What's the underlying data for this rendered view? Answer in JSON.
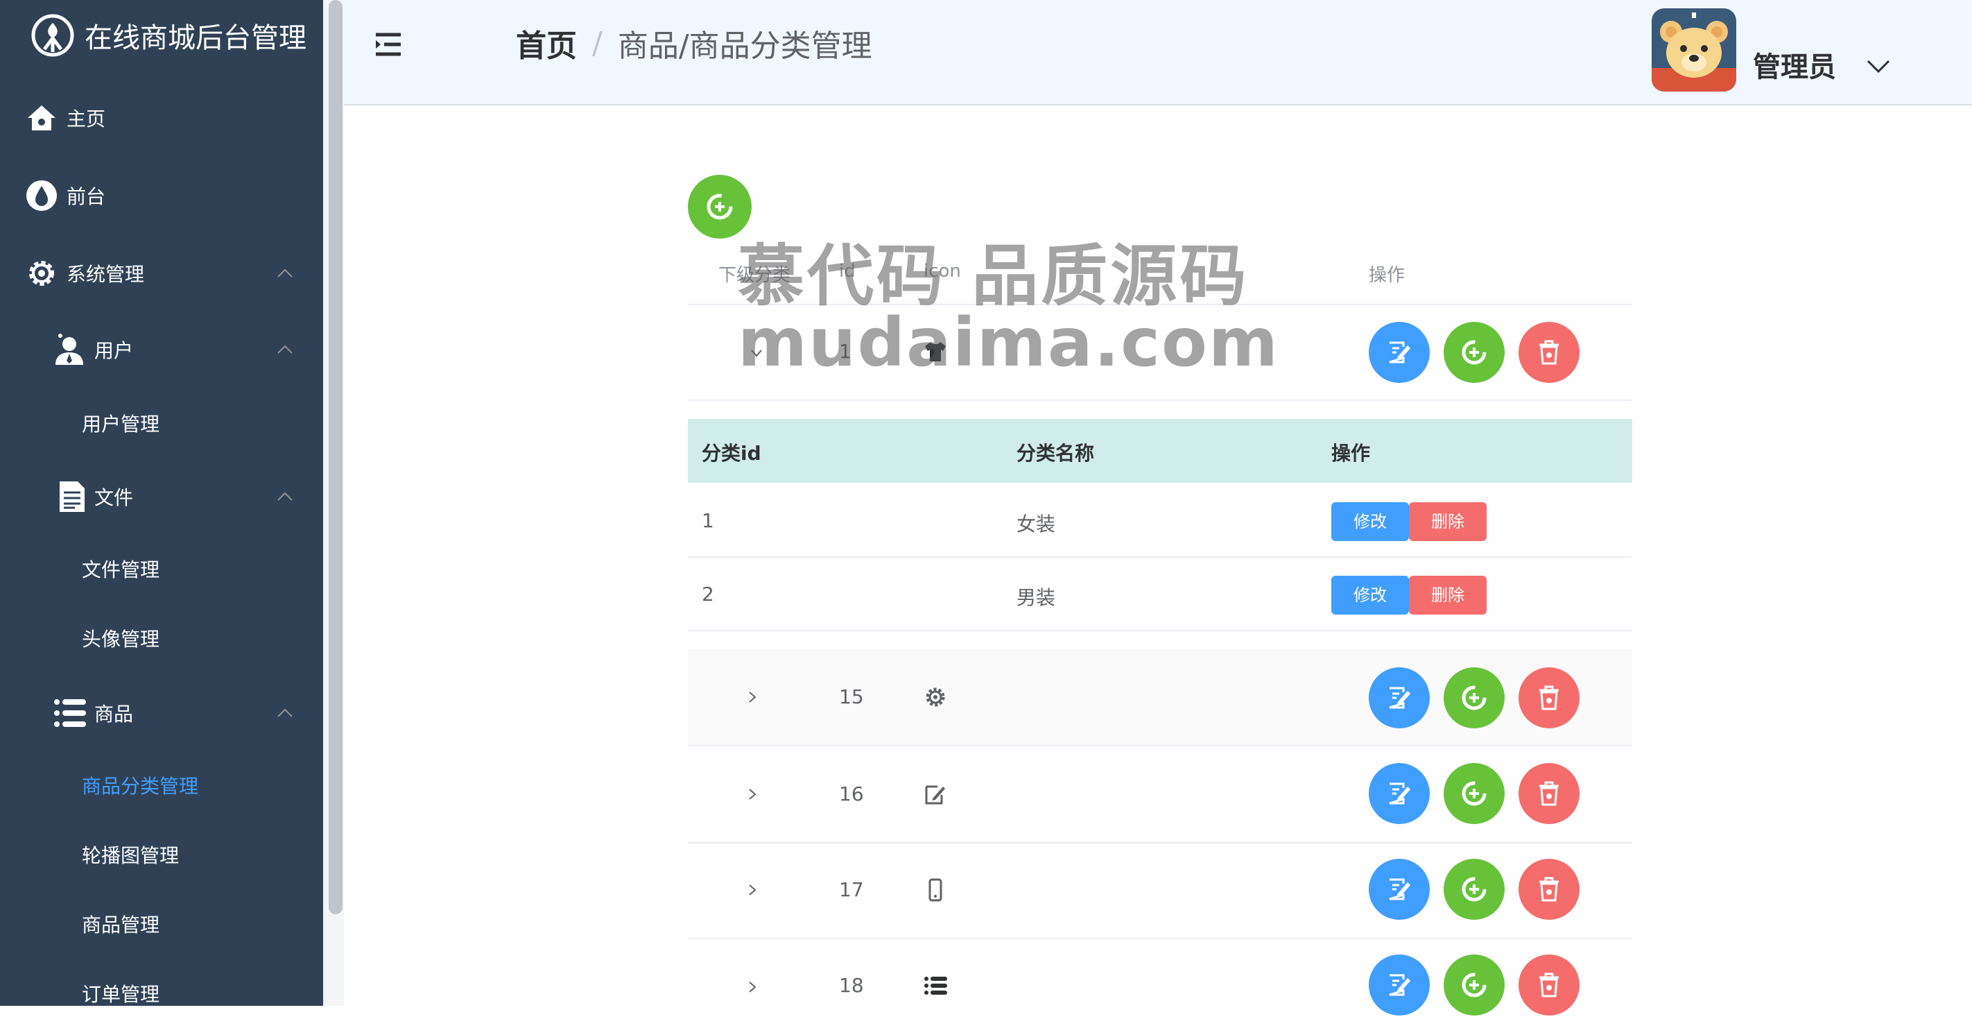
{
  "app": {
    "title": "在线商城后台管理"
  },
  "sidebar": {
    "items": [
      {
        "label": "主页",
        "icon": "home-icon"
      },
      {
        "label": "前台",
        "icon": "drop-icon"
      },
      {
        "label": "系统管理",
        "icon": "gear-icon"
      },
      {
        "label": "用户",
        "icon": "user-icon"
      },
      {
        "label": "用户管理"
      },
      {
        "label": "文件",
        "icon": "document-icon"
      },
      {
        "label": "文件管理"
      },
      {
        "label": "头像管理"
      },
      {
        "label": "商品",
        "icon": "list-icon"
      },
      {
        "label": "商品分类管理",
        "active": true
      },
      {
        "label": "轮播图管理"
      },
      {
        "label": "商品管理"
      },
      {
        "label": "订单管理"
      }
    ]
  },
  "header": {
    "breadcrumb_home": "首页",
    "breadcrumb_sep": "/",
    "breadcrumb_current": "商品/商品分类管理",
    "user_name": "管理员"
  },
  "table": {
    "columns": [
      "下级分类",
      "id",
      "icon",
      "操作"
    ],
    "rows": [
      {
        "id": "1",
        "icon": "shirt-icon",
        "expanded": true
      },
      {
        "id": "15",
        "icon": "gear-icon"
      },
      {
        "id": "16",
        "icon": "edit-icon"
      },
      {
        "id": "17",
        "icon": "phone-icon"
      },
      {
        "id": "18",
        "icon": "list-icon"
      }
    ]
  },
  "subtable": {
    "columns": [
      "分类id",
      "分类名称",
      "操作"
    ],
    "rows": [
      {
        "id": "1",
        "name": "女装",
        "edit": "修改",
        "delete": "删除"
      },
      {
        "id": "2",
        "name": "男装",
        "edit": "修改",
        "delete": "删除"
      }
    ]
  },
  "watermark": {
    "line1": "慕代码 品质源码",
    "line2": "mudaima.com"
  },
  "colors": {
    "sidebar_bg": "#304156",
    "active": "#409eff",
    "primary": "#409eff",
    "success": "#67c23a",
    "danger": "#f56c6c",
    "subheader_bg": "#d1ede9"
  }
}
